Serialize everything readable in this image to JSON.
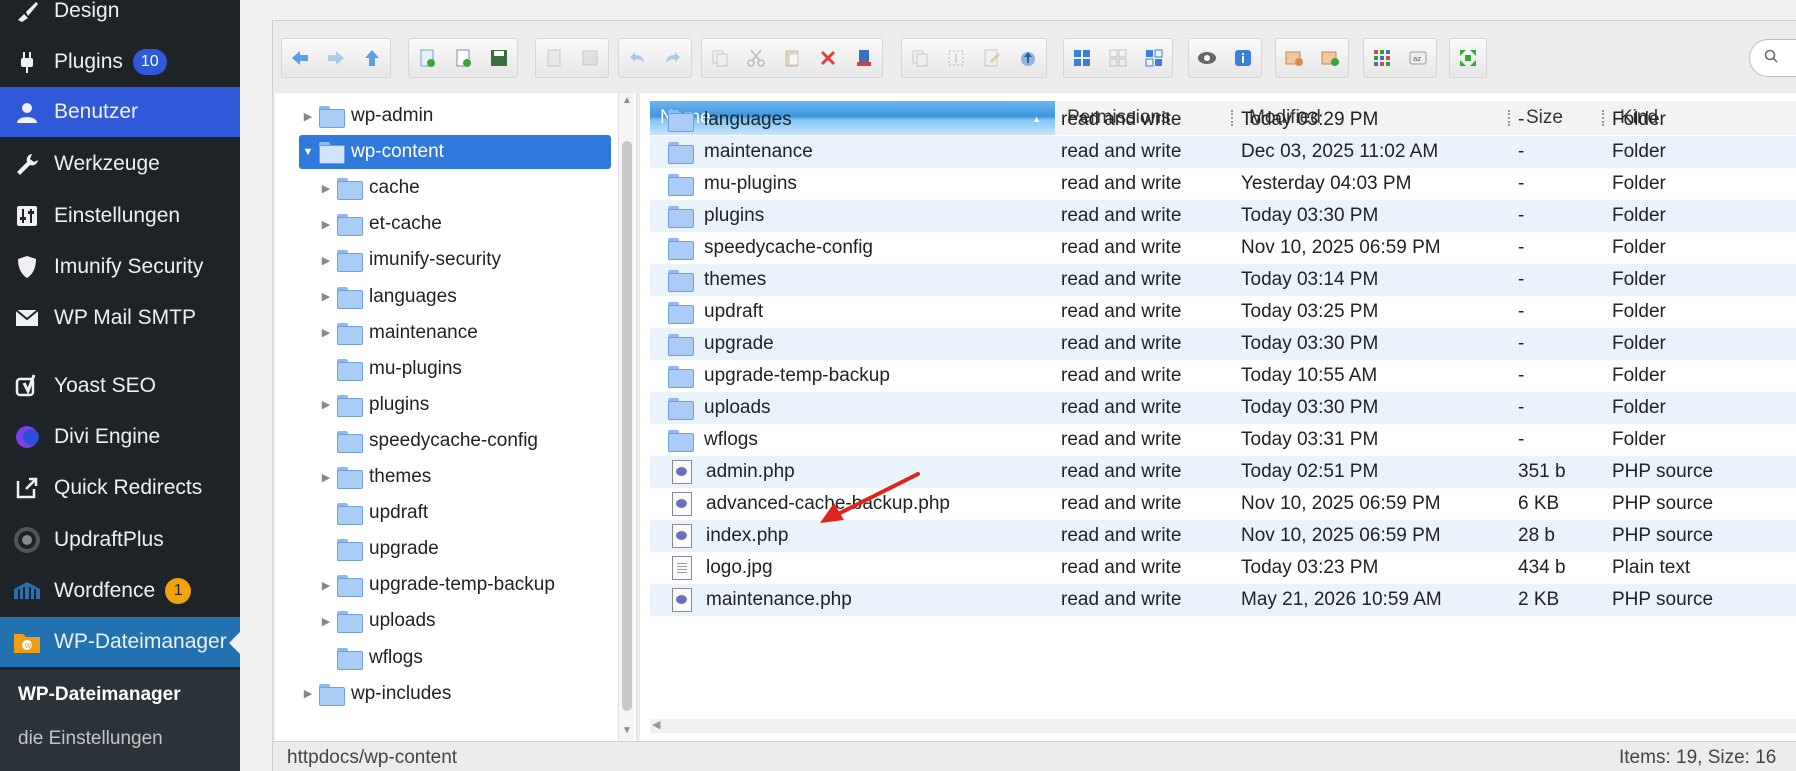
{
  "sidebar": {
    "items": [
      {
        "label": "Design",
        "icon": "brush-icon"
      },
      {
        "label": "Plugins",
        "icon": "plugin-icon",
        "badge": "10"
      },
      {
        "label": "Benutzer",
        "icon": "user-icon"
      },
      {
        "label": "Werkzeuge",
        "icon": "wrench-icon"
      },
      {
        "label": "Einstellungen",
        "icon": "settings-sliders-icon"
      },
      {
        "label": "Imunify Security",
        "icon": "shield-icon"
      },
      {
        "label": "WP Mail SMTP",
        "icon": "mail-icon"
      },
      {
        "label": "Yoast SEO",
        "icon": "yoast-icon"
      },
      {
        "label": "Divi Engine",
        "icon": "divi-engine-icon"
      },
      {
        "label": "Quick Redirects",
        "icon": "external-link-icon"
      },
      {
        "label": "UpdraftPlus",
        "icon": "updraftplus-icon"
      },
      {
        "label": "Wordfence",
        "icon": "wordfence-icon",
        "badge": "1"
      },
      {
        "label": "WP-Dateimanager",
        "icon": "file-manager-icon"
      }
    ],
    "submenu": {
      "title": "WP-Dateimanager",
      "link": "die Einstellungen"
    }
  },
  "tree": {
    "items": [
      {
        "label": "wp-admin",
        "expandable": true,
        "level": 1
      },
      {
        "label": "wp-content",
        "expandable": true,
        "expanded": true,
        "level": 1,
        "selected": true
      },
      {
        "label": "cache",
        "expandable": true,
        "level": 2
      },
      {
        "label": "et-cache",
        "expandable": true,
        "level": 2
      },
      {
        "label": "imunify-security",
        "expandable": true,
        "level": 2
      },
      {
        "label": "languages",
        "expandable": true,
        "level": 2
      },
      {
        "label": "maintenance",
        "expandable": true,
        "level": 2
      },
      {
        "label": "mu-plugins",
        "expandable": false,
        "level": 2
      },
      {
        "label": "plugins",
        "expandable": true,
        "level": 2
      },
      {
        "label": "speedycache-config",
        "expandable": false,
        "level": 2
      },
      {
        "label": "themes",
        "expandable": true,
        "level": 2
      },
      {
        "label": "updraft",
        "expandable": false,
        "level": 2
      },
      {
        "label": "upgrade",
        "expandable": false,
        "level": 2
      },
      {
        "label": "upgrade-temp-backup",
        "expandable": true,
        "level": 2
      },
      {
        "label": "uploads",
        "expandable": true,
        "level": 2
      },
      {
        "label": "wflogs",
        "expandable": false,
        "level": 2
      },
      {
        "label": "wp-includes",
        "expandable": true,
        "level": 1
      }
    ]
  },
  "list": {
    "headers": {
      "name": "Name",
      "permissions": "Permissions",
      "modified": "Modified",
      "size": "Size",
      "kind": "Kind"
    },
    "rows": [
      {
        "name": "languages",
        "perm": "read and write",
        "mod": "Today 03:29 PM",
        "size": "-",
        "kind": "Folder",
        "type": "folder"
      },
      {
        "name": "maintenance",
        "perm": "read and write",
        "mod": "Dec 03, 2025 11:02 AM",
        "size": "-",
        "kind": "Folder",
        "type": "folder"
      },
      {
        "name": "mu-plugins",
        "perm": "read and write",
        "mod": "Yesterday 04:03 PM",
        "size": "-",
        "kind": "Folder",
        "type": "folder"
      },
      {
        "name": "plugins",
        "perm": "read and write",
        "mod": "Today 03:30 PM",
        "size": "-",
        "kind": "Folder",
        "type": "folder"
      },
      {
        "name": "speedycache-config",
        "perm": "read and write",
        "mod": "Nov 10, 2025 06:59 PM",
        "size": "-",
        "kind": "Folder",
        "type": "folder"
      },
      {
        "name": "themes",
        "perm": "read and write",
        "mod": "Today 03:14 PM",
        "size": "-",
        "kind": "Folder",
        "type": "folder"
      },
      {
        "name": "updraft",
        "perm": "read and write",
        "mod": "Today 03:25 PM",
        "size": "-",
        "kind": "Folder",
        "type": "folder"
      },
      {
        "name": "upgrade",
        "perm": "read and write",
        "mod": "Today 03:30 PM",
        "size": "-",
        "kind": "Folder",
        "type": "folder"
      },
      {
        "name": "upgrade-temp-backup",
        "perm": "read and write",
        "mod": "Today 10:55 AM",
        "size": "-",
        "kind": "Folder",
        "type": "folder"
      },
      {
        "name": "uploads",
        "perm": "read and write",
        "mod": "Today 03:30 PM",
        "size": "-",
        "kind": "Folder",
        "type": "folder"
      },
      {
        "name": "wflogs",
        "perm": "read and write",
        "mod": "Today 03:31 PM",
        "size": "-",
        "kind": "Folder",
        "type": "folder"
      },
      {
        "name": "admin.php",
        "perm": "read and write",
        "mod": "Today 02:51 PM",
        "size": "351 b",
        "kind": "PHP source",
        "type": "php"
      },
      {
        "name": "advanced-cache-backup.php",
        "perm": "read and write",
        "mod": "Nov 10, 2025 06:59 PM",
        "size": "6 KB",
        "kind": "PHP source",
        "type": "php"
      },
      {
        "name": "index.php",
        "perm": "read and write",
        "mod": "Nov 10, 2025 06:59 PM",
        "size": "28 b",
        "kind": "PHP source",
        "type": "php"
      },
      {
        "name": "logo.jpg",
        "perm": "read and write",
        "mod": "Today 03:23 PM",
        "size": "434 b",
        "kind": "Plain text",
        "type": "img"
      },
      {
        "name": "maintenance.php",
        "perm": "read and write",
        "mod": "May 21, 2026 10:59 AM",
        "size": "2 KB",
        "kind": "PHP source",
        "type": "php"
      }
    ]
  },
  "statusbar": {
    "path": "httpdocs/wp-content",
    "stats": "Items: 19, Size: 16"
  },
  "colors": {
    "sidebar_bg": "#1d2327",
    "active_menu": "#2f59d8",
    "selection": "#2f79db",
    "annotation": "#e0241b"
  }
}
